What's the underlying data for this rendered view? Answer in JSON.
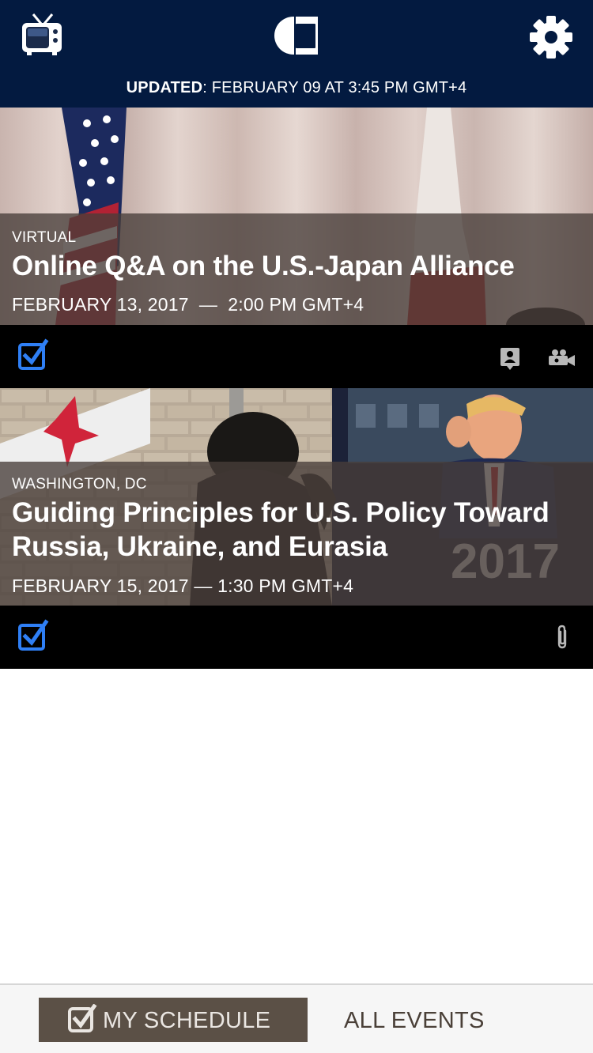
{
  "header": {
    "updated_label": "UPDATED",
    "updated_value": ": FEBRUARY 09 AT 3:45 PM GMT+4",
    "icons": {
      "left": "tv-icon",
      "center": "logo",
      "right": "gear-icon"
    }
  },
  "events": [
    {
      "location": "VIRTUAL",
      "title": "Online Q&A on the U.S.-Japan Alliance",
      "date": "FEBRUARY 13, 2017  —  2:00 PM GMT+4",
      "checked": true,
      "action_icons": [
        "speaker-icon",
        "video-camera-icon"
      ]
    },
    {
      "location": "WASHINGTON, DC",
      "title": "Guiding Principles for U.S. Policy Toward Russia, Ukraine, and Eurasia",
      "date": "FEBRUARY 15, 2017 — 1:30 PM GMT+4",
      "checked": true,
      "action_icons": [
        "paperclip-icon"
      ]
    }
  ],
  "tabs": {
    "my_schedule": "MY SCHEDULE",
    "all_events": "ALL EVENTS"
  },
  "colors": {
    "header_bg": "#031a40",
    "check_blue": "#2f7ff5",
    "tab_active_bg": "#5b5046",
    "overlay": "#483e3a"
  }
}
